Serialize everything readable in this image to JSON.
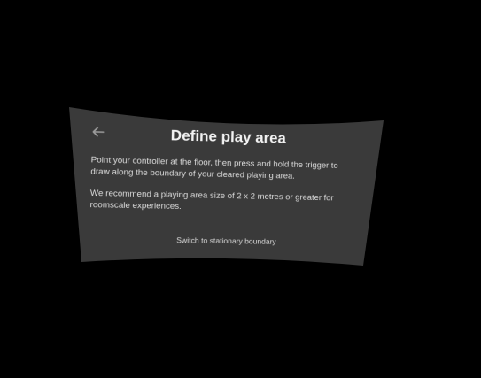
{
  "dialog": {
    "title": "Define play area",
    "back_icon": "arrow-left-icon",
    "instruction": "Point your controller at the floor, then press and hold the trigger to draw along the boundary of your cleared playing area.",
    "recommendation": "We recommend a playing area size of 2 x 2 metres or greater for roomscale experiences.",
    "switch_link": "Switch to stationary boundary"
  },
  "colors": {
    "background": "#000000",
    "panel": "#3a3a3a",
    "text": "#e9e9e9"
  }
}
